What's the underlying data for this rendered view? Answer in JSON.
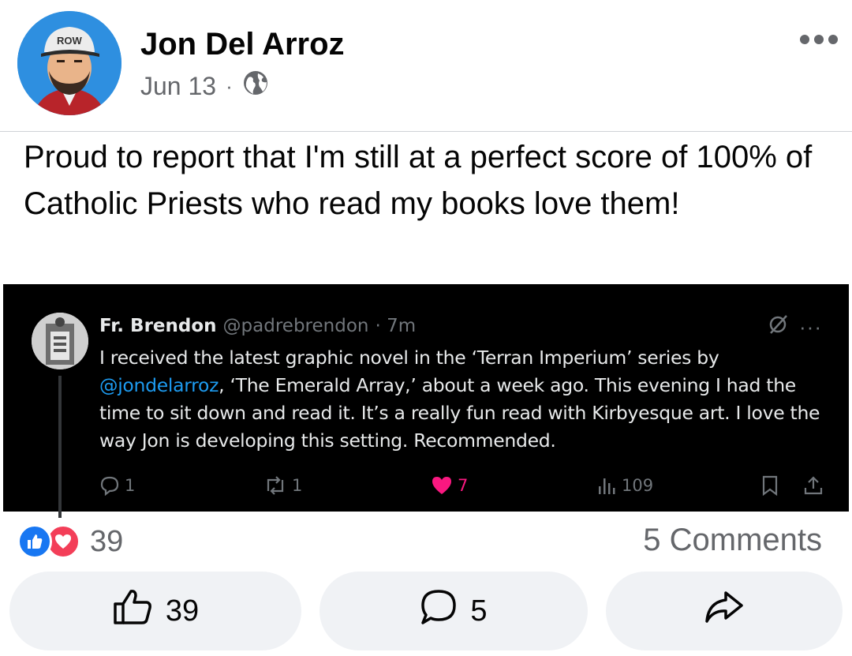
{
  "post": {
    "author": "Jon Del Arroz",
    "date": "Jun 13",
    "separator": "·",
    "audience_icon": "globe-icon",
    "text": "Proud to report that I'm still at a perfect score of 100% of Catholic Priests who read my books love them!"
  },
  "tweet": {
    "name": "Fr. Brendon",
    "handle": "@padrebrendon",
    "time": "· 7m",
    "body_part1": "I received the latest graphic novel in the ‘Terran Imperium’ series by ",
    "mention": "@jondelarroz",
    "body_part2": ", ‘The Emerald Array,’ about a week ago. This evening I had the time to sit down and read it. It’s a really fun read with Kirbyesque art. I love the way Jon is developing this setting. Recommended.",
    "replies": "1",
    "retweets": "1",
    "likes": "7",
    "views": "109",
    "like_color": "#f91880",
    "mention_color": "#1d9bf0"
  },
  "reactions": {
    "count": "39",
    "comments_label": "5 Comments"
  },
  "actions": {
    "like_count": "39",
    "comment_count": "5"
  },
  "colors": {
    "facebook_blue": "#1877f2",
    "love_red": "#f33e58",
    "secondary_text": "#65676b",
    "button_bg": "#f0f2f5"
  }
}
